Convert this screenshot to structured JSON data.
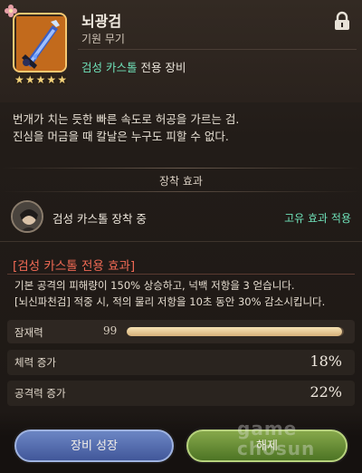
{
  "item": {
    "name": "뇌광검",
    "type": "기원 무기",
    "exclusive_hero": "검성 카스톨",
    "exclusive_suffix": "전용 장비",
    "stars": 5,
    "description_lines": [
      "번개가 치는 듯한 빠른 속도로 허공을 가르는 검.",
      "진심을 머금을 때 칼날은 누구도 피할 수 없다."
    ]
  },
  "equip_effect": {
    "section_title": "장착 효과",
    "equip_label": "검성 카스톨 장착 중",
    "status": "고유 효과 적용"
  },
  "exclusive_bonus": {
    "title": "[검성 카스톨 전용 효과]",
    "lines": [
      "기본 공격의 피해량이 150% 상승하고, 넉백 저항을 3 얻습니다.",
      "[뇌신파천검] 적중 시, 적의 물리 저항을 10초 동안 30% 감소시킵니다."
    ]
  },
  "stats": {
    "potential_label": "잠재력",
    "potential_value": "99",
    "potential_fraction": 0.99,
    "rows": [
      {
        "label": "체력 증가",
        "value": "18%"
      },
      {
        "label": "공격력 증가",
        "value": "22%"
      }
    ]
  },
  "buttons": {
    "grow": "장비 성장",
    "unequip": "해제"
  },
  "watermark": {
    "line1": "game",
    "line2": "chosun"
  },
  "colors": {
    "accent_green": "#6fe0b8",
    "accent_red": "#f06a55",
    "button_blue": "#41579a",
    "button_green": "#4d7424"
  },
  "icons": {
    "lock": "lock-icon",
    "flower": "flower-icon",
    "weapon": "sword-icon",
    "star": "star-icon",
    "avatar": "hero-avatar"
  }
}
